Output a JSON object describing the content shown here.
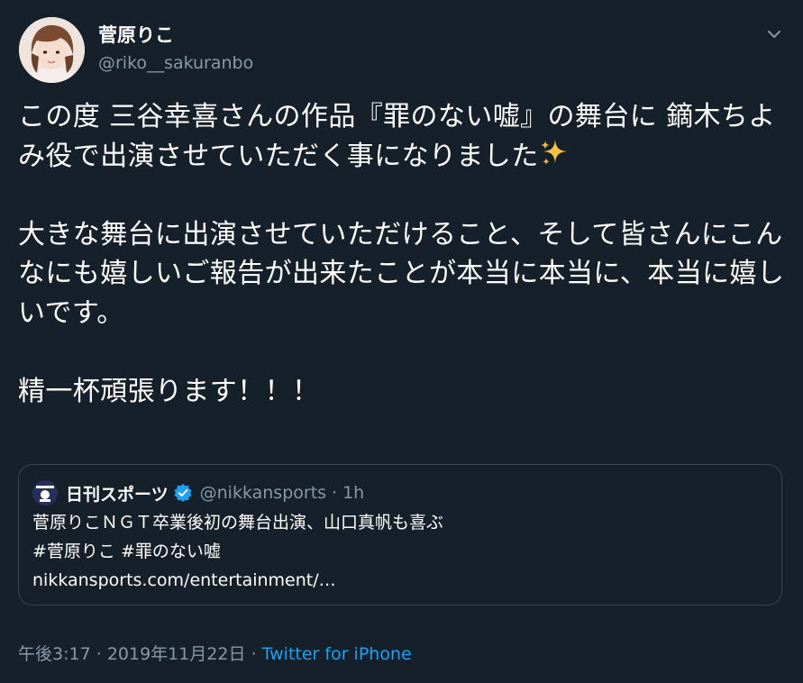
{
  "author": {
    "display_name": "菅原りこ",
    "handle": "@riko__sakuranbo"
  },
  "tweet": {
    "paragraph_1": "この度 三谷幸喜さんの作品『罪のない嘘』の舞台に 鏑木ちよみ役で出演させていただく事になりました",
    "paragraph_2": "大きな舞台に出演させていただけること、そして皆さんにこんなにも嬉しいご報告が出来たことが本当に本当に、本当に嬉しいです。",
    "paragraph_3": "精一杯頑張ります！！！"
  },
  "quoted": {
    "display_name": "日刊スポーツ",
    "handle": "@nikkansports",
    "separator": "·",
    "time": "1h",
    "headline": "菅原りこＮＧＴ卒業後初の舞台出演、山口真帆も喜ぶ",
    "hashtags": "#菅原りこ #罪のない嘘",
    "link": "nikkansports.com/entertainment/…"
  },
  "meta": {
    "time": "午後3:17",
    "separator_1": "·",
    "date": "2019年11月22日",
    "separator_2": "·",
    "source": "Twitter for iPhone"
  },
  "colors": {
    "background": "#15202b",
    "text": "#ffffff",
    "secondary": "#8899a6",
    "accent": "#1da1f2",
    "border": "#38444d"
  },
  "icons": {
    "caret": "chevron-down-icon",
    "sparkles": "sparkles-emoji-icon",
    "verified": "verified-badge-icon"
  }
}
